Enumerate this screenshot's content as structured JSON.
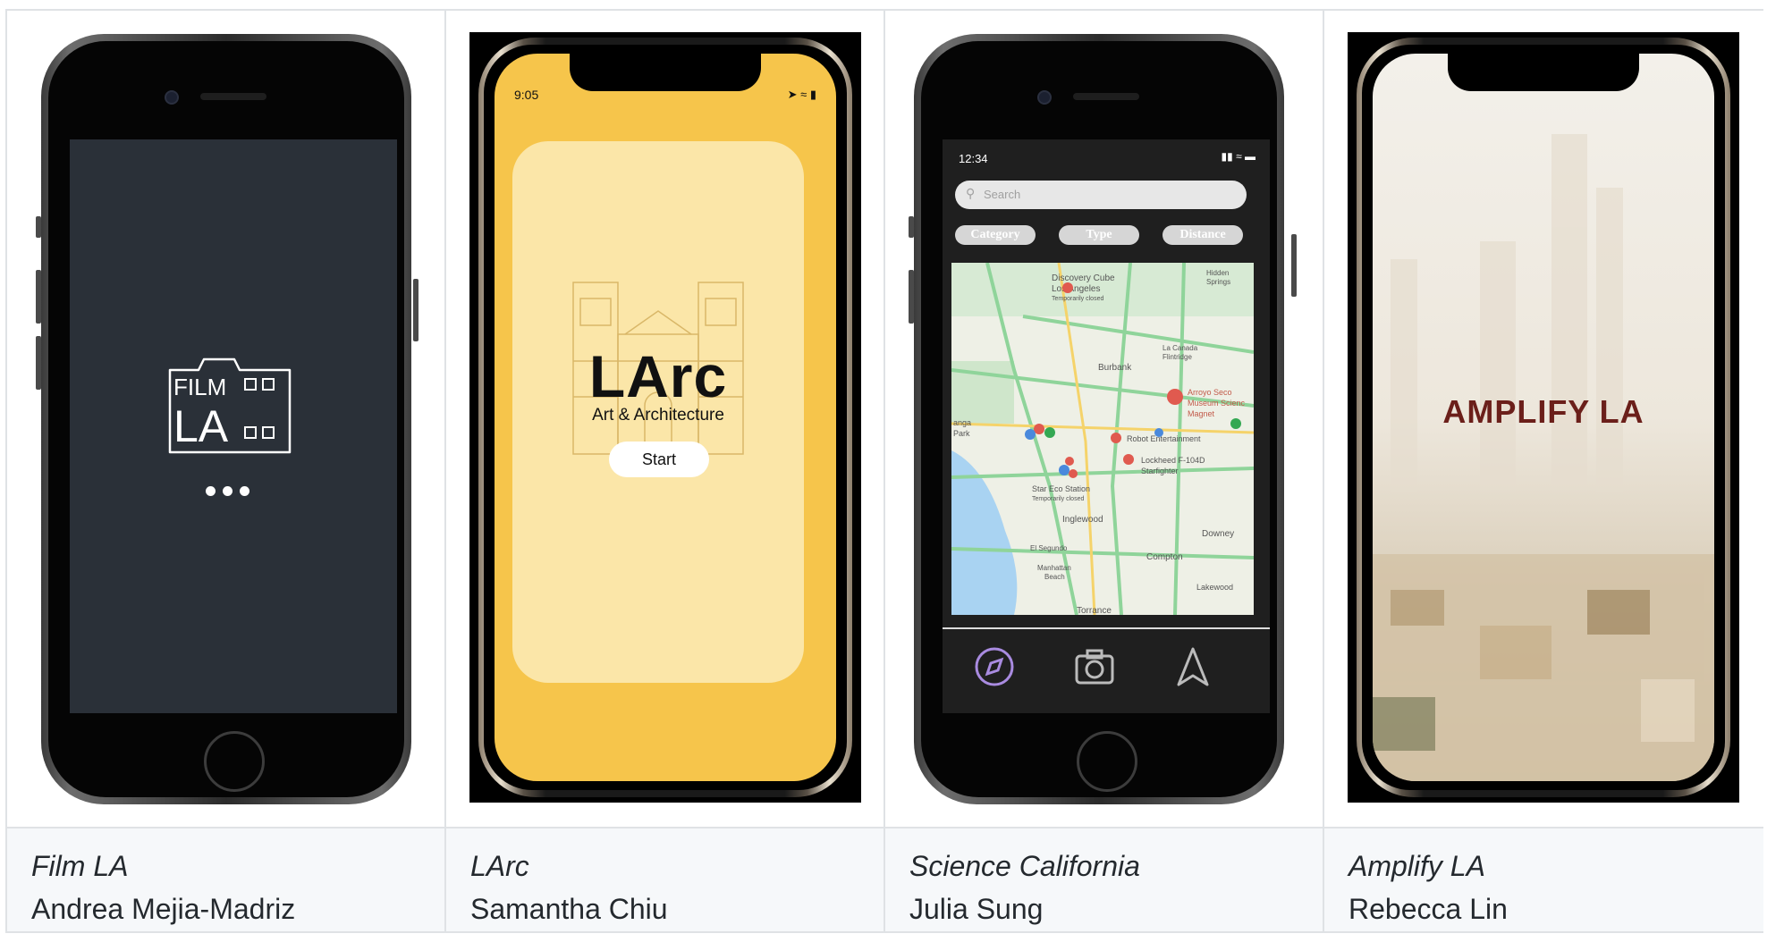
{
  "projects": [
    {
      "title": "Film LA",
      "author": "Andrea Mejia-Madriz",
      "screen": {
        "logo_line1": "FILM",
        "logo_line2": "LA",
        "bg": "#2a3038"
      }
    },
    {
      "title": "LArc",
      "author": "Samantha Chiu",
      "screen": {
        "time": "9:05",
        "heading": "LArc",
        "subtitle": "Art & Architecture",
        "button": "Start",
        "bg": "#f6c54b"
      }
    },
    {
      "title": "Science California",
      "author": "Julia Sung",
      "screen": {
        "time": "12:34",
        "search_placeholder": "Search",
        "filters": [
          "Category",
          "Type",
          "Distance"
        ],
        "map_labels": [
          "Discovery Cube",
          "Los Angeles",
          "Temporarily closed",
          "Burbank",
          "La Canada",
          "Flintridge",
          "Arroyo Seco",
          "Museum Scienc",
          "Magnet",
          "Robot Entertainment",
          "Lockheed F-104D",
          "Starfighter",
          "Star Eco Station",
          "Temporarily closed",
          "Inglewood",
          "El Segundo",
          "Manhattan",
          "Beach",
          "Downey",
          "Compton",
          "Lakewood",
          "Torrance",
          "anga",
          "Park",
          "Hidden",
          "Springs"
        ],
        "tabs": [
          "compass-icon",
          "camera-icon",
          "navigate-icon"
        ]
      }
    },
    {
      "title": "Amplify LA",
      "author": "Rebecca Lin",
      "screen": {
        "heading": "AMPLIFY LA"
      }
    }
  ]
}
